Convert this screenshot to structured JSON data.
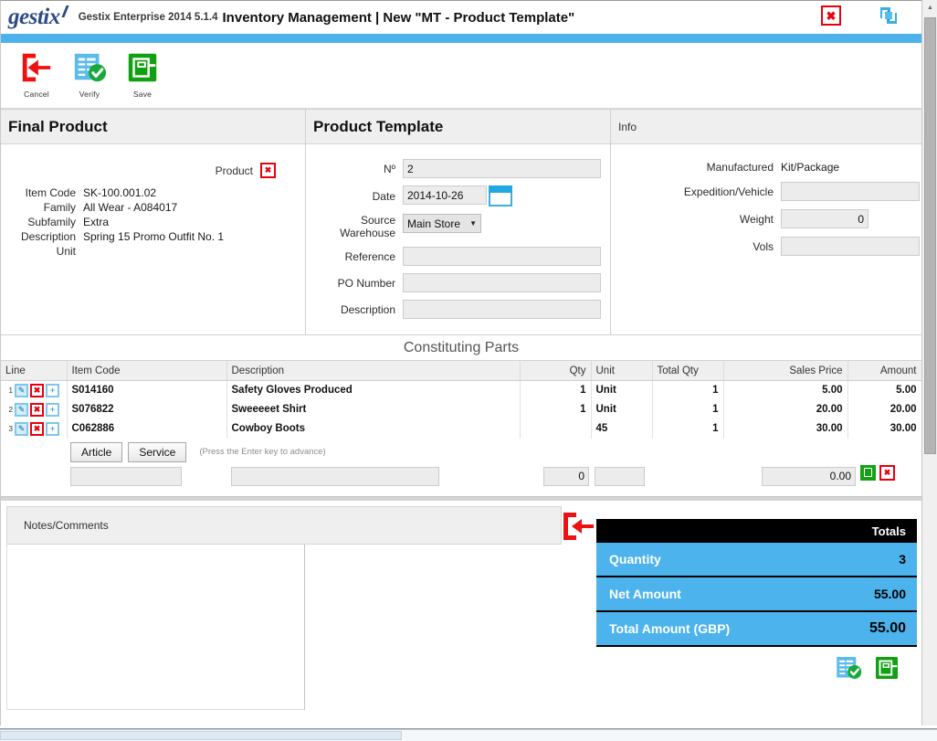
{
  "titlebar": {
    "logo_text": "gestix",
    "app_name": "Gestix Enterprise 2014 5.1.4",
    "doc_title": "Inventory Management | New \"MT - Product Template\"",
    "close_icon": "close-icon",
    "refresh_icon": "refresh-sync-icon"
  },
  "toolbar": {
    "items": [
      {
        "label": "Cancel",
        "icon": "cancel-back-arrow-icon"
      },
      {
        "label": "Verify",
        "icon": "verify-checklist-icon"
      },
      {
        "label": "Save",
        "icon": "save-disk-icon"
      }
    ]
  },
  "final_product": {
    "title": "Final Product",
    "product_label": "Product",
    "delete_icon": "delete-product-icon",
    "fields": [
      {
        "label": "Item Code",
        "value": "SK-100.001.02"
      },
      {
        "label": "Family",
        "value": "All Wear - A084017"
      },
      {
        "label": "Subfamily",
        "value": "Extra"
      },
      {
        "label": "Description",
        "value": "Spring 15 Promo Outfit No. 1"
      },
      {
        "label": "Unit",
        "value": ""
      }
    ]
  },
  "product_template": {
    "title": "Product Template",
    "number_label": "Nº",
    "number_value": "2",
    "date_label": "Date",
    "date_value": "2014-10-26",
    "calendar_icon": "calendar-picker-icon",
    "warehouse_label_line1": "Source",
    "warehouse_label_line2": "Warehouse",
    "warehouse_value": "Main Store",
    "warehouse_options": [
      "Main Store"
    ],
    "reference_label": "Reference",
    "reference_value": "",
    "po_label": "PO Number",
    "po_value": "",
    "description_label": "Description",
    "description_value": ""
  },
  "info": {
    "title": "Info",
    "manufactured_label": "Manufactured",
    "manufactured_value": "Kit/Package",
    "expedition_label": "Expedition/Vehicle",
    "expedition_value": "",
    "weight_label": "Weight",
    "weight_value": "0",
    "vols_label": "Vols",
    "vols_value": ""
  },
  "parts": {
    "section_title": "Constituting Parts",
    "columns": [
      "Line",
      "Item Code",
      "Description",
      "Qty",
      "Unit",
      "Total Qty",
      "Sales Price",
      "Amount"
    ],
    "rows": [
      {
        "line": "1",
        "item_code": "S014160",
        "description": "Safety Gloves Produced",
        "qty": "1",
        "unit": "Unit",
        "total_qty": "1",
        "sales_price": "5.00",
        "amount": "5.00"
      },
      {
        "line": "2",
        "item_code": "S076822",
        "description": "Sweeeeet Shirt",
        "qty": "1",
        "unit": "Unit",
        "total_qty": "1",
        "sales_price": "20.00",
        "amount": "20.00"
      },
      {
        "line": "3",
        "item_code": "C062886",
        "description": "Cowboy Boots",
        "qty": "",
        "unit": "45",
        "total_qty": "1",
        "sales_price": "30.00",
        "amount": "30.00"
      }
    ],
    "row_icons": {
      "edit": "edit-row-icon",
      "delete": "delete-row-icon",
      "add": "add-row-icon"
    }
  },
  "entry": {
    "article_button": "Article",
    "service_button": "Service",
    "hint": "(Press the Enter key to advance)",
    "item_code_value": "",
    "description_value": "",
    "qty_value": "0",
    "unit_value": "",
    "amount_value": "0.00",
    "save_icon": "save-line-icon",
    "delete_icon": "delete-line-icon"
  },
  "notes": {
    "title": "Notes/Comments",
    "value": ""
  },
  "totals": {
    "header": "Totals",
    "rows": [
      {
        "label": "Quantity",
        "value": "3"
      },
      {
        "label": "Net Amount",
        "value": "55.00"
      },
      {
        "label": "Total Amount (GBP)",
        "value": "55.00"
      }
    ],
    "verify_icon": "verify-checklist-icon",
    "save_icon": "save-disk-icon"
  },
  "annotation": {
    "arrow_icon": "red-back-arrow-annotation"
  },
  "colors": {
    "accent": "#4db3ec",
    "danger": "#e8000d",
    "success": "#15a015",
    "header_bg": "#efefef",
    "totals_header_bg": "#000000"
  }
}
